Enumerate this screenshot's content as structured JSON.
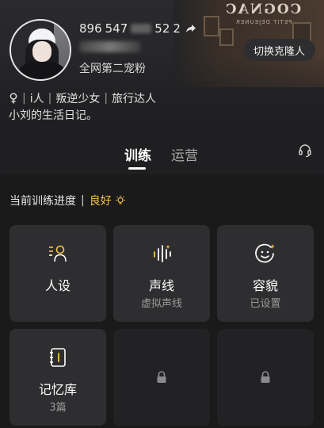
{
  "profile": {
    "uid_visible_start": "896",
    "uid_visible_end": "2",
    "uid_middle_partial": "547",
    "uid_partial_2": "52",
    "rank_text": "全网第二宠粉",
    "clone_button_label": "切换克隆人",
    "tags": [
      "i人",
      "叛逆少女",
      "旅行达人"
    ],
    "bio": "小刘的生活日记。"
  },
  "background_sign": {
    "main": "COGNAC",
    "sub": "PETIT DEJEUNER"
  },
  "tabs": [
    {
      "label": "训练",
      "active": true
    },
    {
      "label": "运营",
      "active": false
    }
  ],
  "progress": {
    "label": "当前训练进度",
    "separator": "|",
    "status": "良好"
  },
  "cards": [
    {
      "title": "人设",
      "subtitle": "",
      "icon": "persona-icon",
      "locked": false
    },
    {
      "title": "声线",
      "subtitle": "虚拟声线",
      "icon": "voice-wave-icon",
      "locked": false
    },
    {
      "title": "容貌",
      "subtitle": "已设置",
      "icon": "face-sparkle-icon",
      "locked": false
    },
    {
      "title": "记忆库",
      "subtitle": "3篇",
      "icon": "memory-book-icon",
      "locked": false
    },
    {
      "title": "",
      "subtitle": "",
      "icon": "lock-icon",
      "locked": true
    },
    {
      "title": "",
      "subtitle": "",
      "icon": "lock-icon",
      "locked": true
    }
  ],
  "colors": {
    "accent_gold": "#f5c34a",
    "card_bg": "#2e2e30",
    "page_bg": "#1a1a1a"
  }
}
